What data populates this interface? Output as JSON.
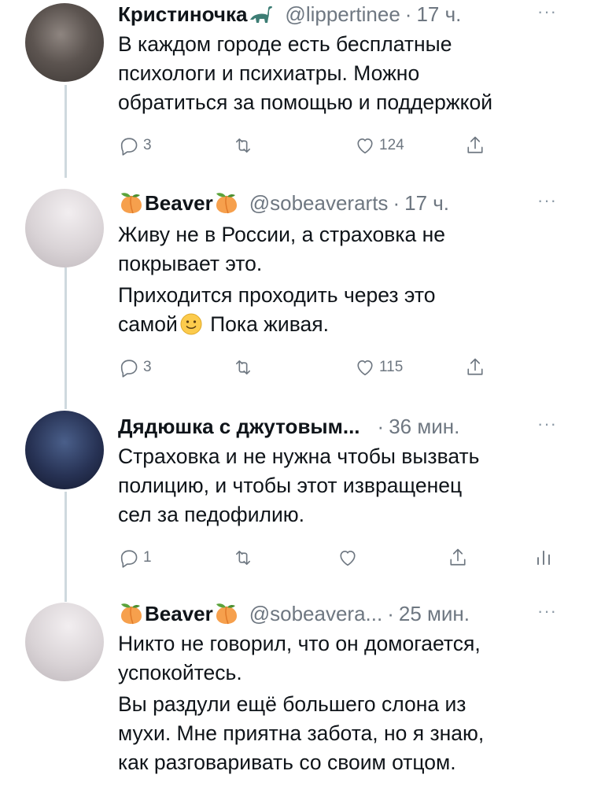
{
  "tweets": [
    {
      "name": "Кристиночка",
      "handle": "@lippertinee",
      "time": "17 ч.",
      "lines": [
        "В каждом городе есть бесплатные",
        "психологи и психиатры. Можно",
        "обратиться за помощью и поддержкой"
      ],
      "reply_count": "3",
      "like_count": "124"
    },
    {
      "name": "Beaver",
      "handle": "@sobeaverarts",
      "time": "17 ч.",
      "para1": [
        "Живу не в России, а страховка не",
        "покрывает это."
      ],
      "para2_line1": "Приходится проходить через это",
      "para2_line2_a": "самой",
      "para2_line2_b": "Пока живая.",
      "reply_count": "3",
      "like_count": "115"
    },
    {
      "name": "Дядюшка с джутовым...",
      "time": "36 мин.",
      "lines": [
        "Страховка и не нужна чтобы вызвать",
        "полицию, и чтобы этот извращенец",
        "сел за педофилию."
      ],
      "reply_count": "1"
    },
    {
      "name": "Beaver",
      "handle": "@sobeavera...",
      "time": "25 мин.",
      "lines": [
        "Никто не говорил, что он домогается,",
        "успокойтесь.",
        "Вы раздули ещё большего слона из",
        "мухи. Мне приятна забота, но я знаю,",
        "как разговаривать со своим отцом."
      ]
    }
  ],
  "more_label": "···",
  "dot": "·",
  "icons": [
    "reply-icon",
    "retweet-icon",
    "like-icon",
    "share-icon",
    "analytics-icon",
    "peach-emoji-icon",
    "dinosaur-emoji-icon",
    "smile-emoji-icon"
  ]
}
